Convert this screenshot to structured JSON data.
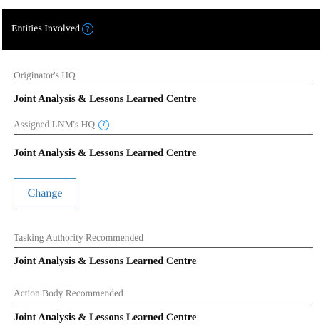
{
  "header": {
    "title": "Entities Involved",
    "help_glyph": "?"
  },
  "fields": {
    "originator_hq": {
      "label": "Originator's HQ",
      "value": "Joint Analysis & Lessons Learned Centre"
    },
    "assigned_lnm_hq": {
      "label": "Assigned LNM's HQ",
      "help_glyph": "?",
      "value": "Joint Analysis & Lessons Learned Centre"
    },
    "tasking_authority": {
      "label": "Tasking Authority Recommended",
      "value": "Joint Analysis & Lessons Learned Centre"
    },
    "action_body": {
      "label": "Action Body Recommended",
      "value": "Joint Analysis & Lessons Learned Centre"
    }
  },
  "actions": {
    "change_label": "Change"
  },
  "colors": {
    "header_background": "#000000",
    "accent": "#2196f3",
    "button_text": "#2a6fa8"
  }
}
